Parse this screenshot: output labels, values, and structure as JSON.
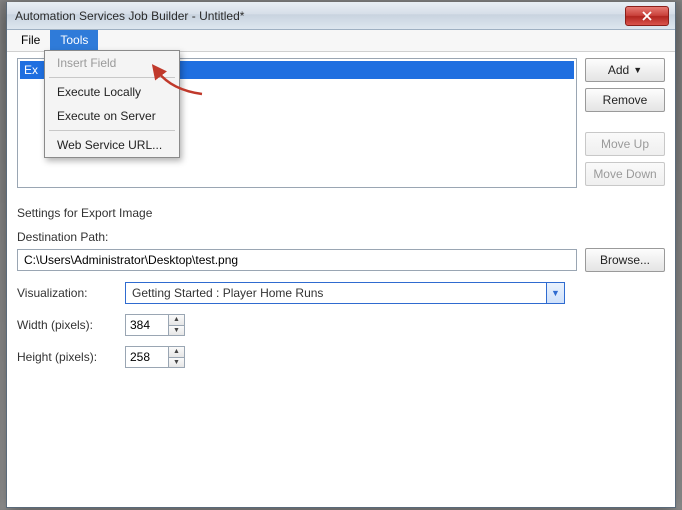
{
  "window": {
    "title": "Automation Services Job Builder - Untitled*"
  },
  "menubar": {
    "file": "File",
    "tools": "Tools"
  },
  "tools_menu": {
    "insert_field": "Insert Field",
    "execute_locally": "Execute Locally",
    "execute_on_server": "Execute on Server",
    "web_service_url": "Web Service URL..."
  },
  "list": {
    "selected": "Ex"
  },
  "buttons": {
    "add": "Add",
    "remove": "Remove",
    "move_up": "Move Up",
    "move_down": "Move Down",
    "browse": "Browse..."
  },
  "settings": {
    "heading": "Settings for Export Image",
    "dest_label": "Destination Path:",
    "dest_value": "C:\\Users\\Administrator\\Desktop\\test.png",
    "viz_label": "Visualization:",
    "viz_value": "Getting Started : Player Home Runs",
    "width_label": "Width (pixels):",
    "width_value": "384",
    "height_label": "Height (pixels):",
    "height_value": "258"
  }
}
